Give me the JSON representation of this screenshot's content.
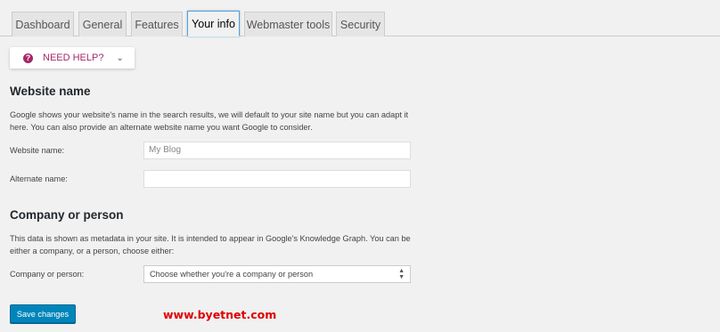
{
  "tabs": [
    {
      "label": "Dashboard"
    },
    {
      "label": "General"
    },
    {
      "label": "Features"
    },
    {
      "label": "Your info"
    },
    {
      "label": "Webmaster tools"
    },
    {
      "label": "Security"
    }
  ],
  "help": {
    "label": "NEED HELP?",
    "icon": "question-icon",
    "chevron_icon": "chevron-down-icon",
    "color": "#a4286a"
  },
  "website_section": {
    "heading": "Website name",
    "description": "Google shows your website's name in the search results, we will default to your site name but you can adapt it here. You can also provide an alternate website name you want Google to consider.",
    "website_name_label": "Website name:",
    "website_name_value": "My Blog",
    "alternate_name_label": "Alternate name:",
    "alternate_name_value": ""
  },
  "company_section": {
    "heading": "Company or person",
    "description": "This data is shown as metadata in your site. It is intended to appear in Google's Knowledge Graph. You can be either a company, or a person, choose either:",
    "select_label": "Company or person:",
    "select_value": "Choose whether you're a company or person"
  },
  "save_label": "Save changes",
  "watermark": "www.byetnet.com",
  "colors": {
    "accent": "#0085ba",
    "brand": "#a4286a",
    "watermark": "#e00000"
  }
}
